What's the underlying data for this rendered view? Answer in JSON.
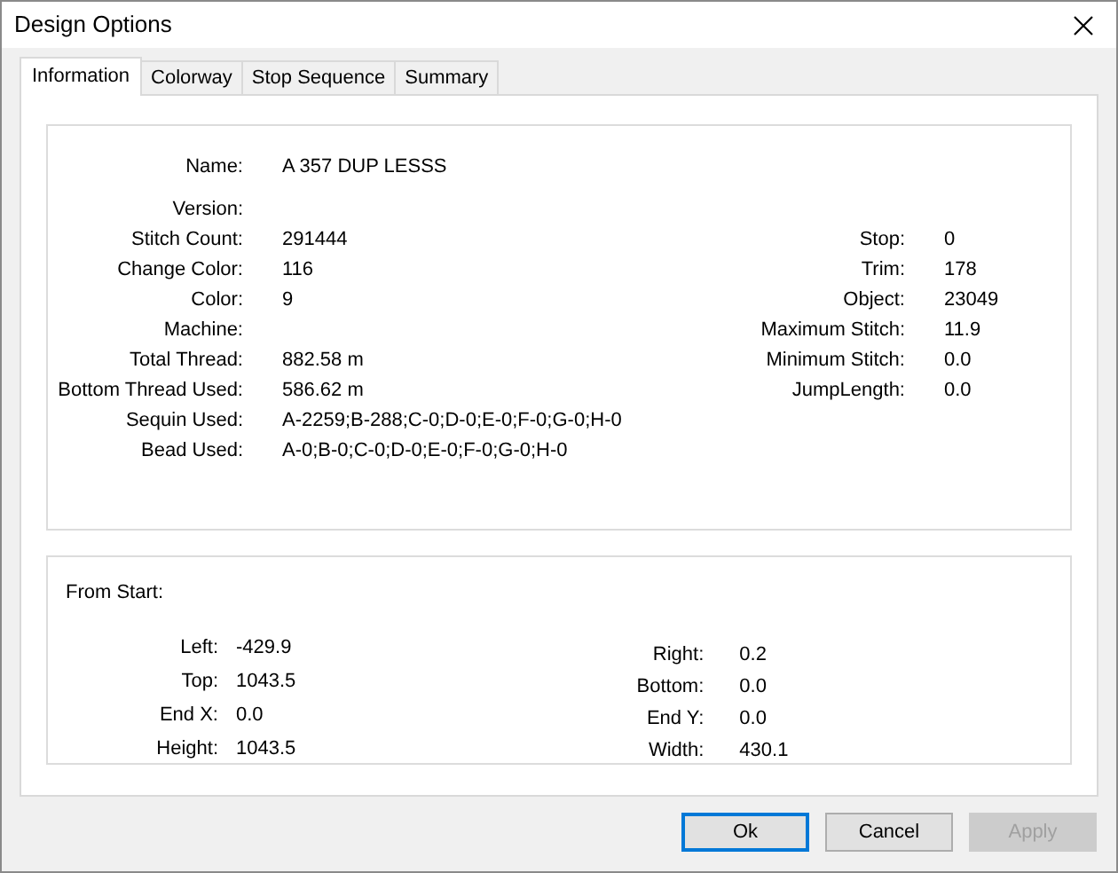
{
  "window": {
    "title": "Design Options"
  },
  "tabs": [
    {
      "label": "Information",
      "selected": true
    },
    {
      "label": "Colorway",
      "selected": false
    },
    {
      "label": "Stop Sequence",
      "selected": false
    },
    {
      "label": "Summary",
      "selected": false
    }
  ],
  "information": {
    "rows": [
      {
        "left": {
          "label": "Name:",
          "value": "A 357 DUP LESSS"
        }
      },
      {
        "left": {
          "label": "Version:"
        }
      },
      {
        "left": {
          "label": "Stitch Count:",
          "value": "291444"
        },
        "right": {
          "label": "Stop:",
          "value": "0"
        }
      },
      {
        "left": {
          "label": "Change Color:",
          "value": "116"
        },
        "right": {
          "label": "Trim:",
          "value": "178"
        }
      },
      {
        "left": {
          "label": "Color:",
          "value": "9"
        },
        "right": {
          "label": "Object:",
          "value": "23049"
        }
      },
      {
        "left": {
          "label": "Machine:"
        },
        "right": {
          "label": "Maximum Stitch:",
          "value": "11.9"
        }
      },
      {
        "left": {
          "label": "Total Thread:",
          "value": "882.58 m"
        },
        "right": {
          "label": "Minimum Stitch:",
          "value": "0.0"
        }
      },
      {
        "left": {
          "label": "Bottom Thread Used:",
          "value": "586.62 m"
        },
        "right": {
          "label": "JumpLength:",
          "value": "0.0"
        }
      },
      {
        "left": {
          "label": "Sequin Used:",
          "value": "A-2259;B-288;C-0;D-0;E-0;F-0;G-0;H-0"
        }
      },
      {
        "left": {
          "label": "Bead Used:",
          "value": "A-0;B-0;C-0;D-0;E-0;F-0;G-0;H-0"
        }
      }
    ]
  },
  "from_start": {
    "title": "From Start:",
    "left": [
      {
        "label": "Left:",
        "value": "-429.9"
      },
      {
        "label": "Top:",
        "value": "1043.5"
      },
      {
        "label": "End X:",
        "value": "0.0"
      },
      {
        "label": "Height:",
        "value": "1043.5"
      }
    ],
    "right": [
      {
        "label": "Right:",
        "value": "0.2"
      },
      {
        "label": "Bottom:",
        "value": "0.0"
      },
      {
        "label": "End Y:",
        "value": "0.0"
      },
      {
        "label": "Width:",
        "value": "430.1"
      }
    ]
  },
  "buttons": [
    {
      "label": "Ok",
      "default": true,
      "disabled": false
    },
    {
      "label": "Cancel",
      "default": false,
      "disabled": false
    },
    {
      "label": "Apply",
      "default": false,
      "disabled": true
    }
  ]
}
